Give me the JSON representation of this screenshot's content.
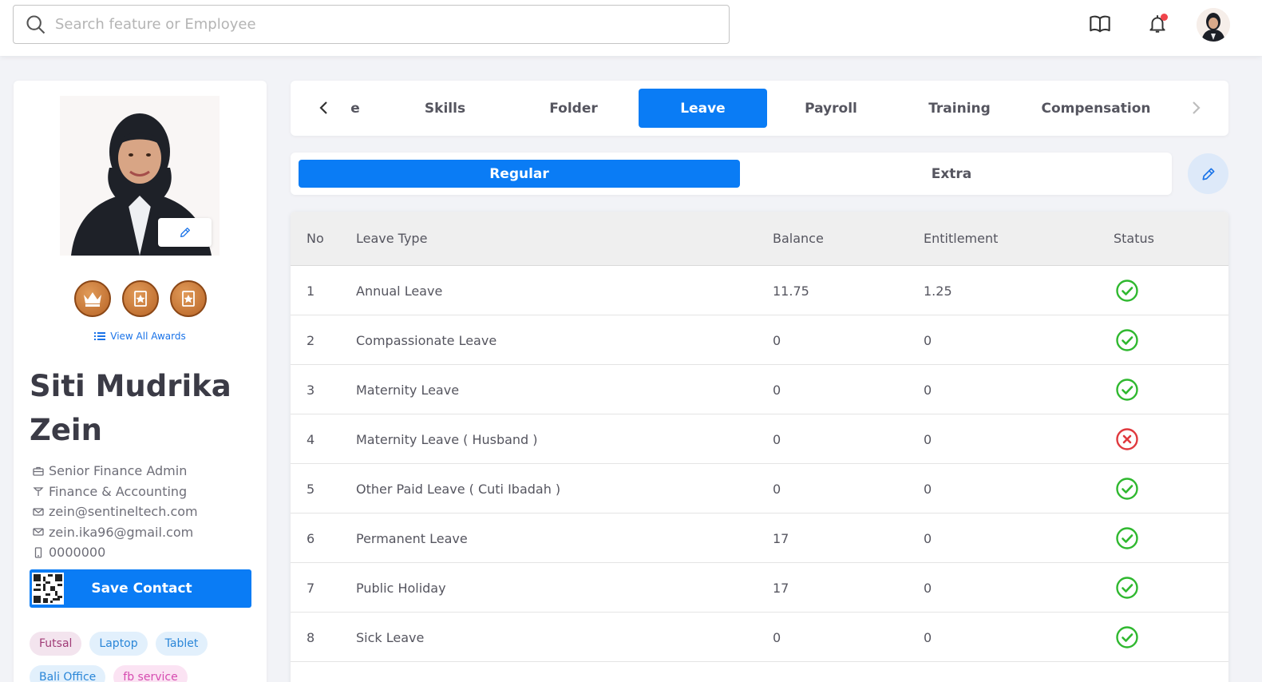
{
  "search": {
    "placeholder": "Search feature or Employee"
  },
  "colors": {
    "accent": "#0a7cf5",
    "status_ok": "#2fb82f",
    "status_bad": "#e0393e"
  },
  "top_icons": [
    "book-icon",
    "bell-icon"
  ],
  "profile": {
    "name": "Siti Mudrika Zein",
    "view_awards": "View All Awards",
    "awards": [
      "crown-award-icon",
      "star-award-icon",
      "star-award-icon"
    ],
    "info": [
      {
        "icon": "briefcase-icon",
        "text": "Senior Finance Admin"
      },
      {
        "icon": "department-icon",
        "text": "Finance & Accounting"
      },
      {
        "icon": "mail-icon",
        "text": "zein@sentineltech.com"
      },
      {
        "icon": "mail-icon",
        "text": "zein.ika96@gmail.com"
      },
      {
        "icon": "phone-icon",
        "text": "0000000"
      }
    ],
    "save_contact": "Save Contact",
    "tags": [
      {
        "label": "Futsal",
        "bg": "#f3e4ee",
        "fg": "#a03c77"
      },
      {
        "label": "Laptop",
        "bg": "#e2f0fc",
        "fg": "#2a86d8"
      },
      {
        "label": "Tablet",
        "bg": "#e2f0fc",
        "fg": "#2a86d8"
      },
      {
        "label": "Bali Office",
        "bg": "#e2f0fc",
        "fg": "#2a86d8"
      },
      {
        "label": "fb service",
        "bg": "#fbe3f3",
        "fg": "#d64bb0"
      }
    ]
  },
  "tabs": {
    "items": [
      "e",
      "Skills",
      "Folder",
      "Leave",
      "Payroll",
      "Training",
      "Compensation"
    ],
    "active": "Leave"
  },
  "subtabs": {
    "regular": "Regular",
    "extra": "Extra",
    "active": "Regular"
  },
  "table": {
    "headers": [
      "No",
      "Leave Type",
      "Balance",
      "Entitlement",
      "Status"
    ],
    "rows": [
      {
        "no": "1",
        "type": "Annual Leave",
        "balance": "11.75",
        "entitlement": "1.25",
        "status": "active"
      },
      {
        "no": "2",
        "type": "Compassionate Leave",
        "balance": "0",
        "entitlement": "0",
        "status": "active"
      },
      {
        "no": "3",
        "type": "Maternity Leave",
        "balance": "0",
        "entitlement": "0",
        "status": "active"
      },
      {
        "no": "4",
        "type": "Maternity Leave ( Husband )",
        "balance": "0",
        "entitlement": "0",
        "status": "inactive"
      },
      {
        "no": "5",
        "type": "Other Paid Leave ( Cuti Ibadah )",
        "balance": "0",
        "entitlement": "0",
        "status": "active"
      },
      {
        "no": "6",
        "type": "Permanent Leave",
        "balance": "17",
        "entitlement": "0",
        "status": "active"
      },
      {
        "no": "7",
        "type": "Public Holiday",
        "balance": "17",
        "entitlement": "0",
        "status": "active"
      },
      {
        "no": "8",
        "type": "Sick Leave",
        "balance": "0",
        "entitlement": "0",
        "status": "active"
      }
    ]
  }
}
